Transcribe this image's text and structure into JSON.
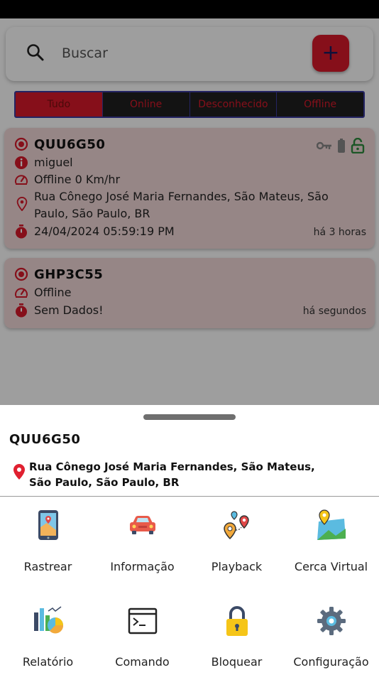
{
  "search": {
    "placeholder": "Buscar",
    "add_label": "+"
  },
  "filters": [
    "Tudo",
    "Online",
    "Desconhecido",
    "Offline"
  ],
  "vehicles": [
    {
      "plate": "QUU6G50",
      "user": "miguel",
      "status": "Offline 0 Km/hr",
      "address": "Rua Cônego José Maria Fernandes, São Mateus, São Paulo, São Paulo, BR",
      "datetime": "24/04/2024 05:59:19 PM",
      "ago": "há 3 horas"
    },
    {
      "plate": "GHP3C55",
      "status": "Offline",
      "datetime": "Sem Dados!",
      "ago": "há segundos"
    }
  ],
  "sheet": {
    "title": "QUU6G50",
    "address": "Rua Cônego José Maria Fernandes, São Mateus, São Paulo, São Paulo, BR",
    "actions": [
      {
        "label": "Rastrear",
        "icon": "phone-map-icon"
      },
      {
        "label": "Informação",
        "icon": "car-icon"
      },
      {
        "label": "Playback",
        "icon": "route-pins-icon"
      },
      {
        "label": "Cerca Virtual",
        "icon": "map-pin-icon"
      },
      {
        "label": "Relatório",
        "icon": "report-chart-icon"
      },
      {
        "label": "Comando",
        "icon": "terminal-icon"
      },
      {
        "label": "Bloquear",
        "icon": "lock-icon"
      },
      {
        "label": "Configuração",
        "icon": "gear-icon"
      }
    ]
  },
  "colors": {
    "accent": "#d8192a",
    "filter_border": "#3a3aa0",
    "card_bg": "#f3d8d8",
    "unlock": "#2e8b3e"
  }
}
